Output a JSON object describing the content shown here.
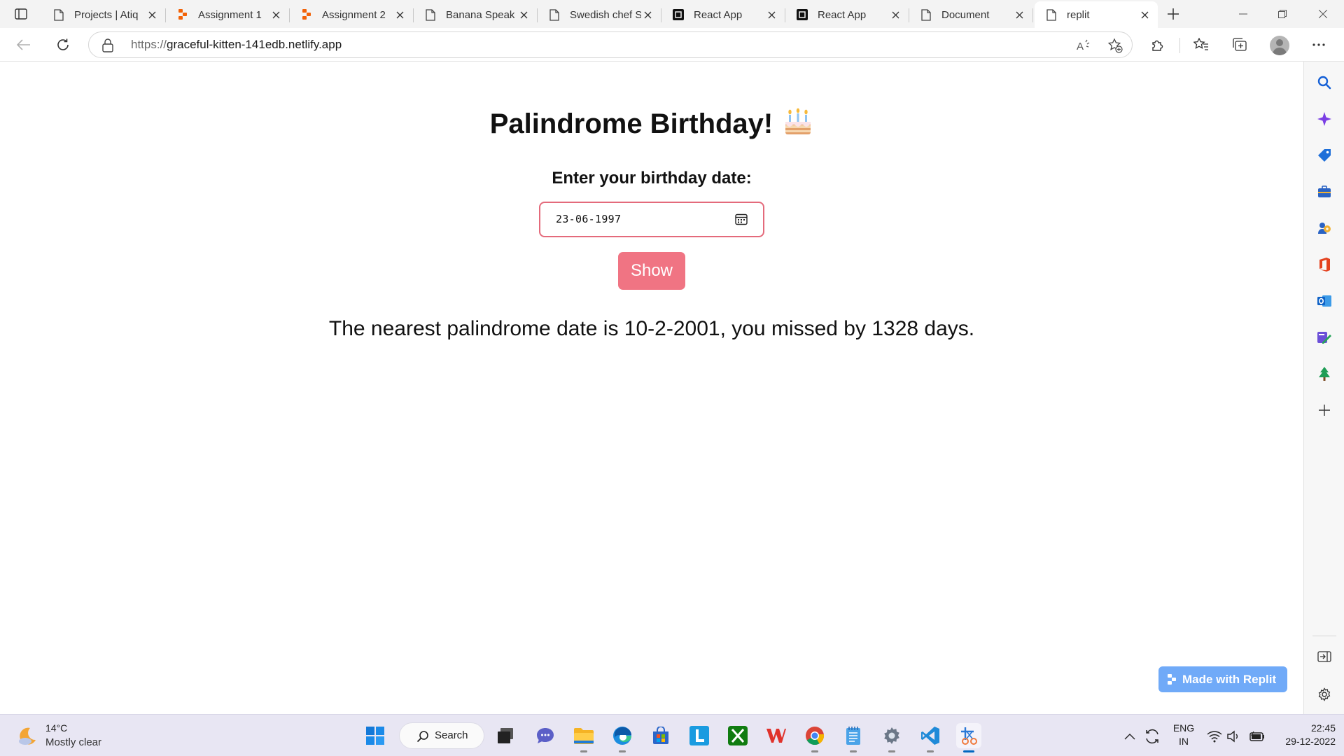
{
  "browser": {
    "tabs": [
      {
        "title": "Projects | Atiq",
        "icon": "page-icon"
      },
      {
        "title": "Assignment 1",
        "icon": "replit-icon"
      },
      {
        "title": "Assignment 2",
        "icon": "replit-icon"
      },
      {
        "title": "Banana Speak",
        "icon": "page-icon"
      },
      {
        "title": "Swedish chef S",
        "icon": "page-icon"
      },
      {
        "title": "React App",
        "icon": "react-app-icon"
      },
      {
        "title": "React App",
        "icon": "react-app-icon"
      },
      {
        "title": "Document",
        "icon": "page-icon"
      },
      {
        "title": "replit",
        "icon": "page-icon",
        "active": true
      }
    ],
    "address": {
      "scheme": "https://",
      "host": "graceful-kitten-141edb.netlify.app"
    }
  },
  "page": {
    "title": "Palindrome Birthday!",
    "title_emoji": "cake-icon",
    "prompt_label": "Enter your birthday date:",
    "date_value": "23-06-1997",
    "show_button": "Show",
    "result": "The nearest palindrome date is 10-2-2001, you missed by 1328 days.",
    "badge": "Made with Replit",
    "accent_color": "#f07483",
    "input_border_color": "#e46a7b"
  },
  "taskbar": {
    "weather": {
      "temp": "14°C",
      "condition": "Mostly clear"
    },
    "search_label": "Search",
    "language": {
      "line1": "ENG",
      "line2": "IN"
    },
    "clock": {
      "time": "22:45",
      "date": "29-12-2022"
    }
  }
}
